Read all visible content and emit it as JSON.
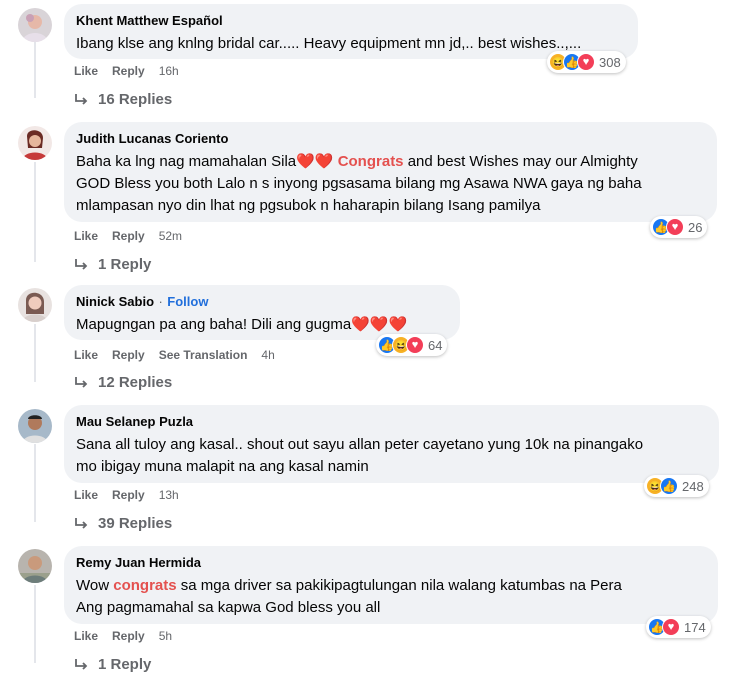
{
  "comments": [
    {
      "name": "Khent Matthew Español",
      "lines": [
        "Ibang klse ang knlng bridal car..... Heavy equipment mn jd,.. best wishes..,..."
      ],
      "actions": {
        "like": "Like",
        "reply": "Reply",
        "see_translation": "",
        "time": "16h"
      },
      "reactions": {
        "icons": [
          "haha-icon",
          "like-icon",
          "love-icon"
        ],
        "count": "308"
      },
      "replies": "16 Replies"
    },
    {
      "name": "Judith Lucanas Coriento",
      "segments": {
        "a": "Baha ka lng nag mamahalan Sila",
        "hearts": "❤️❤️",
        "hl": "Congrats",
        "b": " and best Wishes may our Almighty",
        "line2": "GOD Bless you both Lalo n s inyong pgsasama bilang mg Asawa NWA gaya ng baha",
        "line3": "mlampasan nyo din lhat ng pgsubok n haharapin bilang Isang pamilya"
      },
      "actions": {
        "like": "Like",
        "reply": "Reply",
        "see_translation": "",
        "time": "52m"
      },
      "reactions": {
        "icons": [
          "like-icon",
          "love-icon"
        ],
        "count": "26"
      },
      "replies": "1 Reply"
    },
    {
      "name": "Ninick Sabio",
      "dot": "·",
      "follow": "Follow",
      "segments": {
        "a": "Mapugngan pa ang baha! Dili ang gugma",
        "hearts": "❤️❤️❤️"
      },
      "actions": {
        "like": "Like",
        "reply": "Reply",
        "see_translation": "See Translation",
        "time": "4h"
      },
      "reactions": {
        "icons": [
          "like-icon",
          "haha-icon",
          "love-icon"
        ],
        "count": "64"
      },
      "replies": "12 Replies"
    },
    {
      "name": "Mau Selanep Puzla",
      "lines": [
        "Sana all tuloy ang kasal.. shout out sayu allan peter cayetano yung 10k na pinangako",
        "mo ibigay muna malapit na ang kasal namin"
      ],
      "actions": {
        "like": "Like",
        "reply": "Reply",
        "see_translation": "",
        "time": "13h"
      },
      "reactions": {
        "icons": [
          "haha-icon",
          "like-icon"
        ],
        "count": "248"
      },
      "replies": "39 Replies"
    },
    {
      "name": "Remy Juan Hermida",
      "segments": {
        "a": "Wow ",
        "hl": "congrats",
        "b": " sa mga driver sa pakikipagtulungan nila walang katumbas na Pera",
        "line2": "Ang pagmamahal sa kapwa God bless you all"
      },
      "actions": {
        "like": "Like",
        "reply": "Reply",
        "see_translation": "",
        "time": "5h"
      },
      "reactions": {
        "icons": [
          "like-icon",
          "love-icon"
        ],
        "count": "174"
      },
      "replies": "1 Reply"
    }
  ],
  "colors": {
    "bubble": "#f0f2f5",
    "link": "#216fdb",
    "highlight": "#e4514f",
    "meta": "#65676b"
  }
}
